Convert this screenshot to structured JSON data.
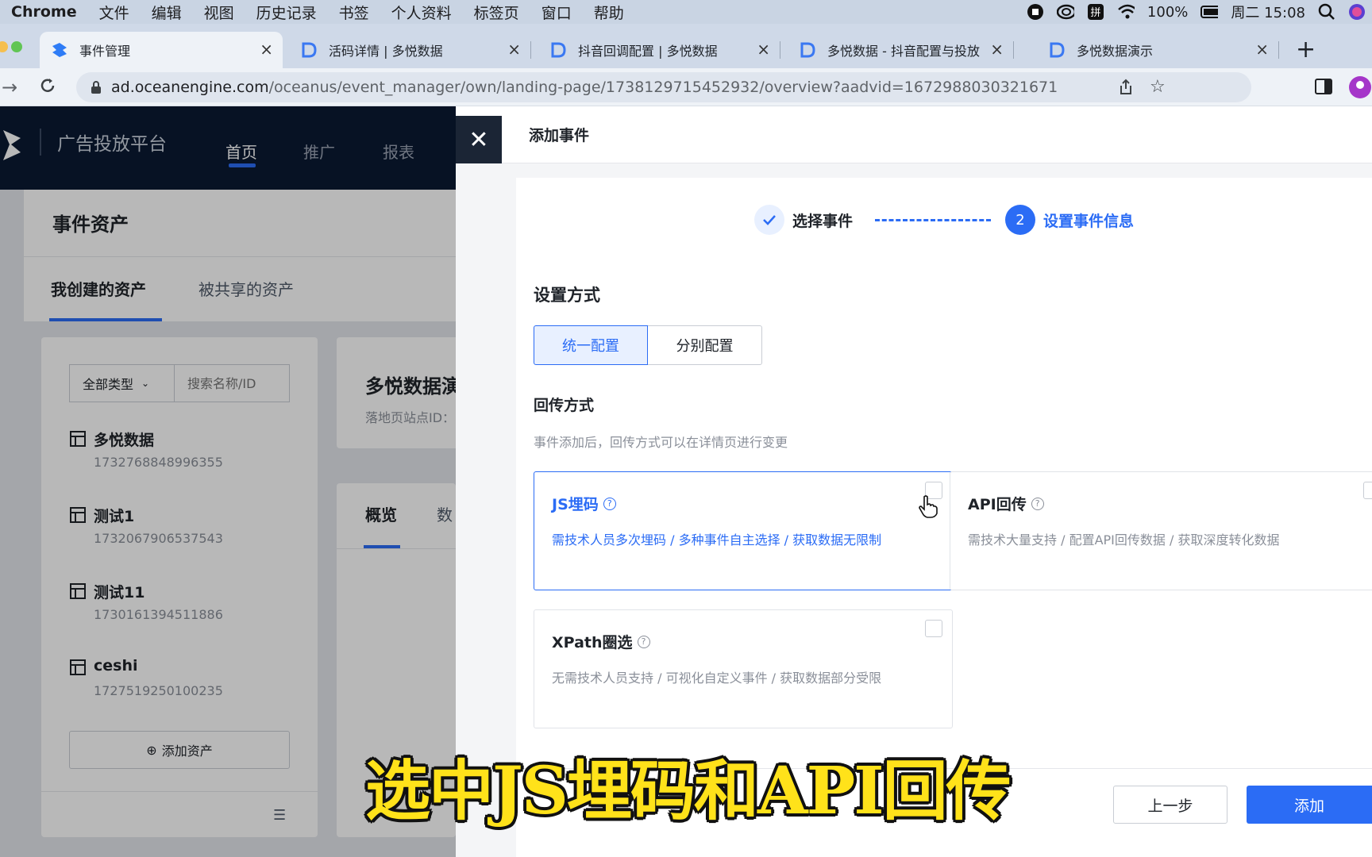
{
  "menubar": {
    "app": "Chrome",
    "items": [
      "文件",
      "编辑",
      "视图",
      "历史记录",
      "书签",
      "个人资料",
      "标签页",
      "窗口",
      "帮助"
    ],
    "battery": "100%",
    "datetime": "周二 15:08"
  },
  "tabs": [
    {
      "title": "事件管理"
    },
    {
      "title": "活码详情 | 多悦数据"
    },
    {
      "title": "抖音回调配置 | 多悦数据"
    },
    {
      "title": "多悦数据 - 抖音配置与投放"
    },
    {
      "title": "多悦数据演示"
    }
  ],
  "address": {
    "host": "ad.oceanengine.com",
    "path": "/oceanus/event_manager/own/landing-page/1738129715452932/overview?aadvid=1672988030321671"
  },
  "app": {
    "brand": "广告投放平台",
    "nav": [
      "首页",
      "推广",
      "报表"
    ],
    "page_title": "事件资产",
    "tabs": [
      "我创建的资产",
      "被共享的资产"
    ],
    "filter_type": "全部类型",
    "search_placeholder": "搜索名称/ID",
    "assets": [
      {
        "name": "多悦数据",
        "id": "1732768848996355"
      },
      {
        "name": "测试1",
        "id": "1732067906537543"
      },
      {
        "name": "测试11",
        "id": "1730161394511886"
      },
      {
        "name": "ceshi",
        "id": "1727519250100235"
      }
    ],
    "add_asset": "添加资产",
    "detail_title": "多悦数据演",
    "detail_site_label": "落地页站点ID：",
    "detail_tabs": [
      "概览",
      "数"
    ]
  },
  "drawer": {
    "title": "添加事件",
    "steps": [
      {
        "label": "选择事件",
        "state": "done"
      },
      {
        "number": "2",
        "label": "设置事件信息",
        "state": "active"
      }
    ],
    "setup_title": "设置方式",
    "setup_options": [
      "统一配置",
      "分别配置"
    ],
    "callback_title": "回传方式",
    "callback_hint": "事件添加后，回传方式可以在详情页进行变更",
    "methods": [
      {
        "title": "JS埋码",
        "desc": "需技术人员多次埋码 / 多种事件自主选择 / 获取数据无限制",
        "selected": true
      },
      {
        "title": "API回传",
        "desc": "需技术大量支持 / 配置API回传数据 / 获取深度转化数据",
        "selected": false
      },
      {
        "title": "XPath圈选",
        "desc": "无需技术人员支持 / 可视化自定义事件 / 获取数据部分受限",
        "selected": false
      }
    ],
    "prev_button": "上一步",
    "add_button": "添加"
  },
  "caption": "选中JS埋码和API回传",
  "colors": {
    "accent": "#2b6cf5",
    "header": "#0b1a33"
  }
}
